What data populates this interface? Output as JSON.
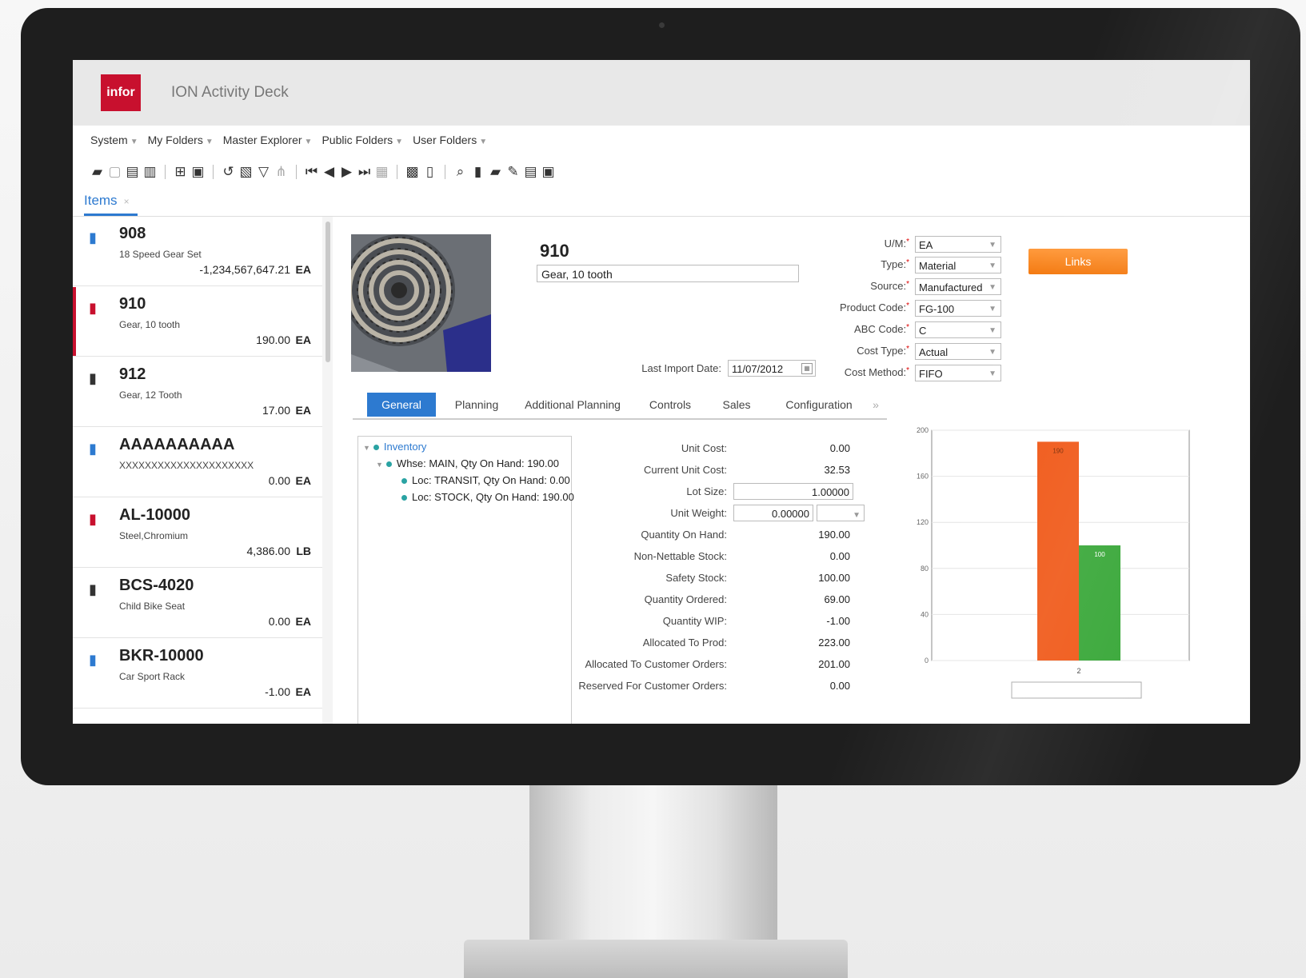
{
  "app": {
    "logo_text": "infor",
    "title": "ION Activity Deck"
  },
  "menu": [
    {
      "label": "System"
    },
    {
      "label": "My Folders"
    },
    {
      "label": "Master Explorer"
    },
    {
      "label": "Public Folders"
    },
    {
      "label": "User Folders"
    }
  ],
  "toolbar_icons": [
    "open-folder-icon",
    "save-icon",
    "save-as-icon",
    "copy-icon",
    "new-record-icon",
    "delete-icon",
    "undo-icon",
    "refresh-icon",
    "filter-icon",
    "sort-icon",
    "first-record-icon",
    "previous-record-icon",
    "next-record-icon",
    "last-record-icon",
    "grid-icon",
    "print-icon",
    "document-icon",
    "find-icon",
    "clipboard-icon",
    "lock-icon",
    "wrench-icon",
    "list-icon",
    "notes-icon"
  ],
  "tabs": {
    "items": "Items"
  },
  "items": [
    {
      "code": "908",
      "desc": "18 Speed Gear Set",
      "qty": "-1,234,567,647.21",
      "uom": "EA",
      "icon_color": "#2d7ad0",
      "selected": false
    },
    {
      "code": "910",
      "desc": "Gear, 10 tooth",
      "qty": "190.00",
      "uom": "EA",
      "icon_color": "#c8102e",
      "selected": true
    },
    {
      "code": "912",
      "desc": "Gear, 12 Tooth",
      "qty": "17.00",
      "uom": "EA",
      "icon_color": "#333333",
      "selected": false
    },
    {
      "code": "AAAAAAAAAA",
      "desc": "XXXXXXXXXXXXXXXXXXXXX",
      "qty": "0.00",
      "uom": "EA",
      "icon_color": "#2d7ad0",
      "selected": false
    },
    {
      "code": "AL-10000",
      "desc": "Steel,Chromium",
      "qty": "4,386.00",
      "uom": "LB",
      "icon_color": "#c8102e",
      "selected": false
    },
    {
      "code": "BCS-4020",
      "desc": "Child Bike Seat",
      "qty": "0.00",
      "uom": "EA",
      "icon_color": "#333333",
      "selected": false
    },
    {
      "code": "BKR-10000",
      "desc": "Car Sport Rack",
      "qty": "-1.00",
      "uom": "EA",
      "icon_color": "#2d7ad0",
      "selected": false
    }
  ],
  "detail": {
    "code": "910",
    "description": "Gear, 10 tooth",
    "links_label": "Links",
    "last_import_label": "Last Import Date:",
    "last_import_date": "11/07/2012",
    "fields": [
      {
        "label": "U/M:",
        "value": "EA"
      },
      {
        "label": "Type:",
        "value": "Material"
      },
      {
        "label": "Source:",
        "value": "Manufactured"
      },
      {
        "label": "Product Code:",
        "value": "FG-100"
      },
      {
        "label": "ABC Code:",
        "value": "C"
      },
      {
        "label": "Cost Type:",
        "value": "Actual"
      },
      {
        "label": "Cost Method:",
        "value": "FIFO"
      }
    ],
    "tabs": [
      {
        "label": "General",
        "active": true
      },
      {
        "label": "Planning"
      },
      {
        "label": "Additional Planning"
      },
      {
        "label": "Controls"
      },
      {
        "label": "Sales"
      },
      {
        "label": "Configuration"
      },
      {
        "label": "»"
      }
    ],
    "tree": {
      "root": "Inventory",
      "warehouse": "Whse: MAIN, Qty On Hand: 190.00",
      "locations": [
        "Loc: TRANSIT, Qty On Hand: 0.00",
        "Loc: STOCK, Qty On Hand: 190.00"
      ]
    },
    "properties": [
      {
        "label": "Unit Cost:",
        "value": "0.00"
      },
      {
        "label": "Current Unit Cost:",
        "value": "32.53"
      },
      {
        "label": "Lot Size:",
        "value": "1.00000"
      },
      {
        "label": "Unit Weight:",
        "value": "0.00000"
      },
      {
        "label": "Quantity On Hand:",
        "value": "190.00"
      },
      {
        "label": "Non-Nettable Stock:",
        "value": "0.00"
      },
      {
        "label": "Safety Stock:",
        "value": "100.00"
      },
      {
        "label": "Quantity Ordered:",
        "value": "69.00"
      },
      {
        "label": "Quantity WIP:",
        "value": "-1.00"
      },
      {
        "label": "Allocated To Prod:",
        "value": "223.00"
      },
      {
        "label": "Allocated To Customer Orders:",
        "value": "201.00"
      },
      {
        "label": "Reserved For Customer Orders:",
        "value": "0.00"
      }
    ]
  },
  "colors": {
    "brand": "#c8102e",
    "accent": "#2d7ad0",
    "button": "#f47a10"
  },
  "chart_data": {
    "type": "bar",
    "categories": [
      "2"
    ],
    "series": [
      {
        "values": [
          190
        ],
        "color": "#f05a1a",
        "label": "190"
      },
      {
        "values": [
          100
        ],
        "color": "#3aa83a",
        "label": "100"
      }
    ],
    "yticks": [
      "200",
      "160",
      "120",
      "80",
      "40",
      "0"
    ],
    "ylim": [
      0,
      200
    ]
  }
}
